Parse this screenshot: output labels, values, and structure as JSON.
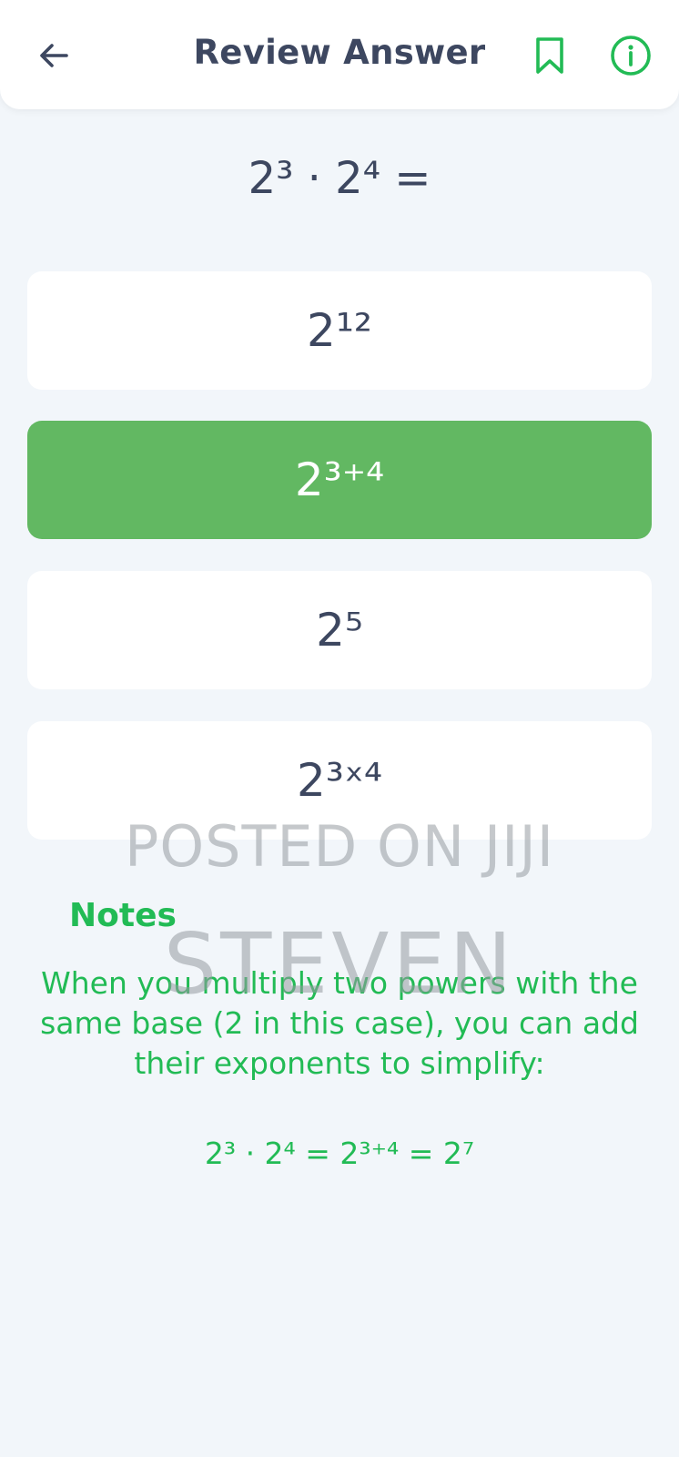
{
  "header": {
    "title": "Review Answer",
    "back_icon": "arrow-left-icon",
    "bookmark_icon": "bookmark-icon",
    "info_icon": "info-icon",
    "accent_color": "#22bb55"
  },
  "question": {
    "text": "2³ · 2⁴ ="
  },
  "options": [
    {
      "label": "2¹²",
      "selected": false
    },
    {
      "label": "2³⁺⁴",
      "selected": true
    },
    {
      "label": "2⁵",
      "selected": false
    },
    {
      "label": "2³ˣ⁴",
      "selected": false
    }
  ],
  "selected_color": "#62b862",
  "watermark": {
    "line1": "POSTED ON JIJI",
    "line2": "STEVEN"
  },
  "notes": {
    "heading": "Notes",
    "body": "When you multiply two powers with the same base (2 in this case), you can add their exponents to simplify:",
    "formula": "2³ · 2⁴ = 2³⁺⁴ = 2⁷"
  }
}
